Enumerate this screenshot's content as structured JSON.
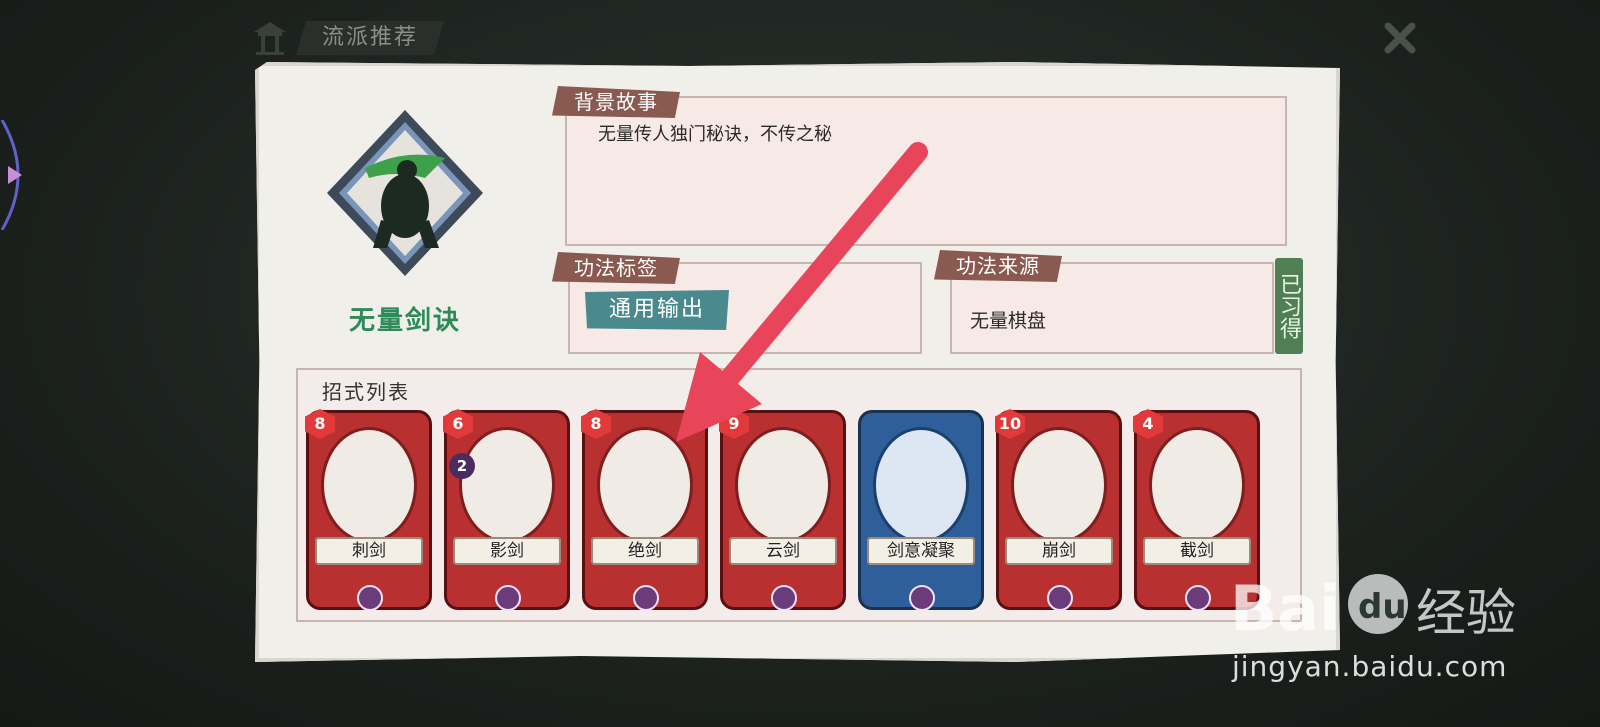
{
  "header": {
    "title": "流派推荐"
  },
  "skill": {
    "name": "无量剑诀"
  },
  "background": {
    "label": "背景故事",
    "text": "无量传人独门秘诀，不传之秘"
  },
  "tags": {
    "label": "功法标签",
    "items": [
      "通用输出"
    ]
  },
  "source": {
    "label": "功法来源",
    "text": "无量棋盘",
    "status": "已习得"
  },
  "moves": {
    "label": "招式列表",
    "cards": [
      {
        "name": "刺剑",
        "cost": "8",
        "color": "red"
      },
      {
        "name": "影剑",
        "cost": "6",
        "color": "red",
        "extra": "2"
      },
      {
        "name": "绝剑",
        "cost": "8",
        "color": "red"
      },
      {
        "name": "云剑",
        "cost": "9",
        "color": "red"
      },
      {
        "name": "剑意凝聚",
        "cost": "",
        "color": "blue"
      },
      {
        "name": "崩剑",
        "cost": "10",
        "color": "red"
      },
      {
        "name": "截剑",
        "cost": "4",
        "color": "red"
      }
    ]
  },
  "watermark": {
    "text": "jingyan.baidu.com",
    "brand": "Bai du 经验"
  },
  "colors": {
    "accent_green": "#2f8a5a",
    "card_red": "#b83030",
    "card_blue": "#2f5f9a",
    "arrow": "#e8455a"
  }
}
